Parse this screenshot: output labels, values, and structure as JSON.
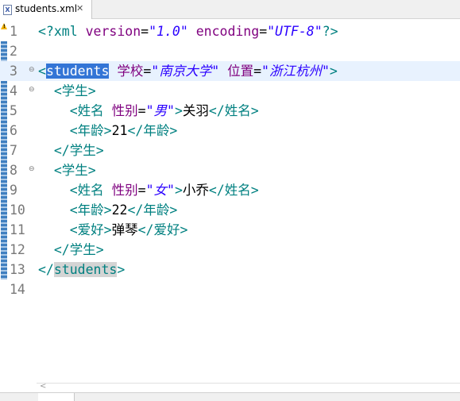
{
  "editor_tab": {
    "file_name": "students.xml",
    "close_glyph": "✕",
    "icon": "xml-file-icon"
  },
  "lines": [
    {
      "num": "1"
    },
    {
      "num": "2"
    },
    {
      "num": "3",
      "fold": "⊖"
    },
    {
      "num": "4",
      "fold": "⊖"
    },
    {
      "num": "5"
    },
    {
      "num": "6"
    },
    {
      "num": "7"
    },
    {
      "num": "8",
      "fold": "⊖"
    },
    {
      "num": "9"
    },
    {
      "num": "10"
    },
    {
      "num": "11"
    },
    {
      "num": "12"
    },
    {
      "num": "13"
    },
    {
      "num": "14"
    }
  ],
  "code": {
    "l1": {
      "open": "<?xml",
      "attr1": "version",
      "eq": "=",
      "val1": "\"1.0\"",
      "attr2": "encoding",
      "val2": "\"UTF-8\"",
      "close": "?>"
    },
    "l3": {
      "lt": "<",
      "name": "students",
      "attr1": "学校",
      "val1": "\"南京大学\"",
      "attr2": "位置",
      "val2": "\"浙江杭州\"",
      "gt": ">"
    },
    "l4": {
      "tag": "<学生>"
    },
    "l5": {
      "open": "<姓名",
      "attr": "性别",
      "eq": "=",
      "val": "\"男\"",
      "gt": ">",
      "text": "关羽",
      "close": "</姓名>"
    },
    "l6": {
      "open": "<年龄>",
      "text": "21",
      "close": "</年龄>"
    },
    "l7": {
      "tag": "</学生>"
    },
    "l8": {
      "tag": "<学生>"
    },
    "l9": {
      "open": "<姓名",
      "attr": "性别",
      "eq": "=",
      "val": "\"女\"",
      "gt": ">",
      "text": "小乔",
      "close": "</姓名>"
    },
    "l10": {
      "open": "<年龄>",
      "text": "22",
      "close": "</年龄>"
    },
    "l11": {
      "open": "<爱好>",
      "text": "弹琴",
      "close": "</爱好>"
    },
    "l12": {
      "tag": "</学生>"
    },
    "l13": {
      "lt": "</",
      "name": "students",
      "gt": ">"
    }
  },
  "status": {
    "warning_icon": "warning-icon"
  }
}
